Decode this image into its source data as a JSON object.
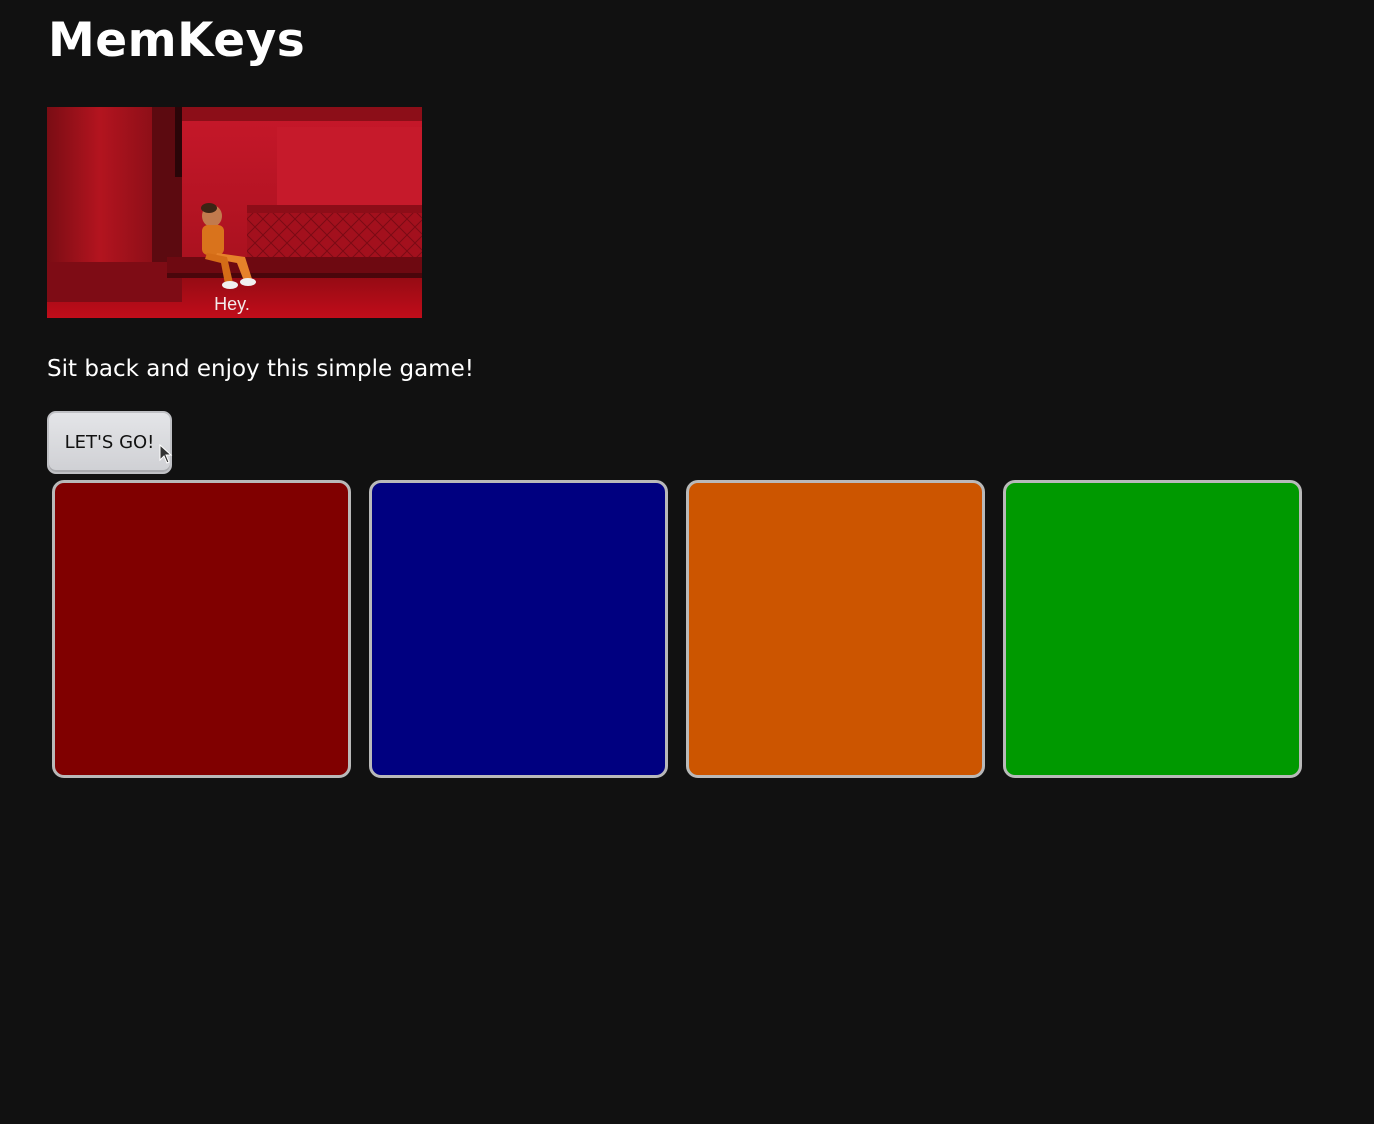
{
  "app": {
    "title": "MemKeys"
  },
  "intro_gif": {
    "caption": "Hey."
  },
  "tagline": "Sit back and enjoy this simple game!",
  "start_button": {
    "label": "LET'S GO!"
  },
  "pads": [
    {
      "name": "red",
      "color": "#800000"
    },
    {
      "name": "blue",
      "color": "#000080"
    },
    {
      "name": "orange",
      "color": "#cc5500"
    },
    {
      "name": "green",
      "color": "#009900"
    }
  ]
}
